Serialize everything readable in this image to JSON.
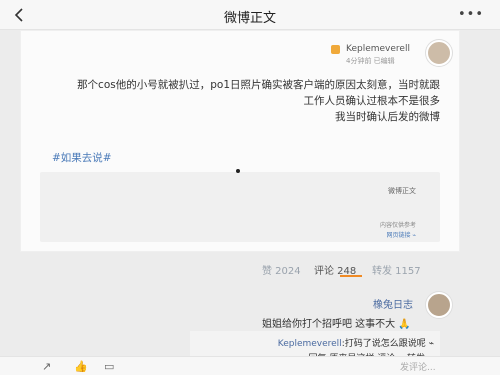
{
  "header": {
    "title": "微博正文",
    "more_label": "•••"
  },
  "post": {
    "author": "Keplemeverell",
    "meta": "4分钟前 已编辑",
    "lines": [
      "那个cos他的小号就被扒过，po1日照片确实被客户端的原因太刻意，当时就跟",
      "工作人员确认过根本不是很多",
      "我当时确认后发的微博"
    ],
    "hashtag": "#如果去说#",
    "quote_title": "微博正文",
    "quote_sub": "内容仅供参考  ",
    "quote_link": "网页链接 ⌁"
  },
  "stats": {
    "reposts": "转发 1157",
    "comments": "评论 248",
    "likes": "赞 2024"
  },
  "comment": {
    "user": "橡兔日志",
    "text": "姐姐给你打个招呼吧 这事不大 🙏",
    "reply_name": "Keplemeverell",
    "reply_text": ":打码了说怎么跟说呢 ⌁",
    "reply_line2": "回复 原来是这样 评论 ▪ 转发 ▪"
  },
  "bottombar": {
    "input_placeholder": "发评论...",
    "icons": [
      "share-icon",
      "comment-icon",
      "like-icon",
      "emoji-icon"
    ]
  }
}
